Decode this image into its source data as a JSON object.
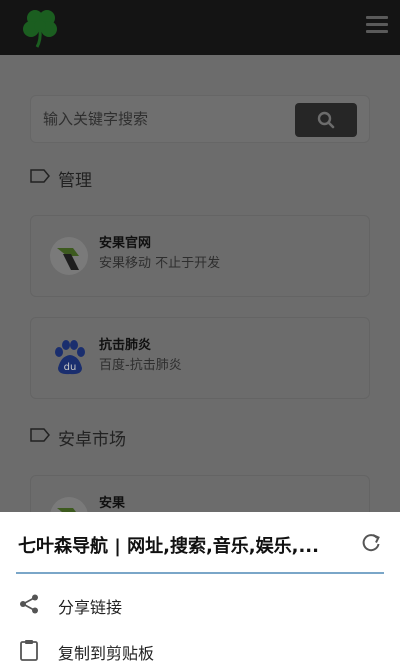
{
  "search": {
    "placeholder": "输入关键字搜索"
  },
  "sections": [
    {
      "label": "管理"
    },
    {
      "label": "安卓市场"
    }
  ],
  "cards": [
    {
      "title": "安果官网",
      "desc": "安果移动 不止于开发"
    },
    {
      "title": "抗击肺炎",
      "desc": "百度-抗击肺炎"
    },
    {
      "title": "安果",
      "desc": ""
    }
  ],
  "sheet": {
    "title": "七叶森导航 | 网址,搜索,音乐,娱乐,...",
    "items": [
      {
        "label": "分享链接",
        "icon": "share-icon"
      },
      {
        "label": "复制到剪贴板",
        "icon": "clipboard-icon"
      }
    ]
  },
  "colors": {
    "accent": "#7aa6c8",
    "overlay": "#6c6c6c"
  }
}
